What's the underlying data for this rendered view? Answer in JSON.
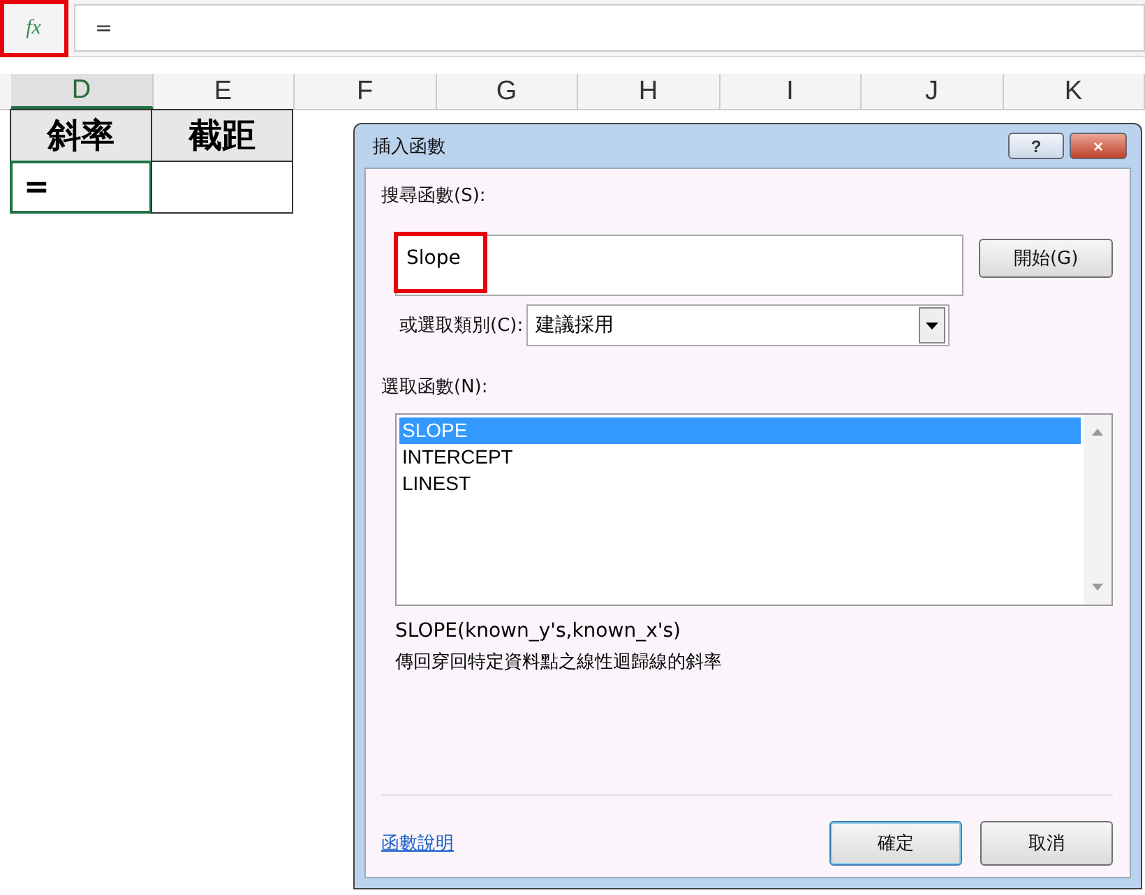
{
  "formula_bar": {
    "fx_label": "fx",
    "value": "="
  },
  "columns": [
    "D",
    "E",
    "F",
    "G",
    "H",
    "I",
    "J",
    "K"
  ],
  "cells": [
    [
      "斜率",
      "="
    ],
    [
      "截距"
    ]
  ],
  "dialog": {
    "title": "插入函數",
    "help_button": "?",
    "close_button": "×",
    "search_label": "搜尋函數(S):",
    "search_value": "Slope",
    "go_button": "開始(G)",
    "category_label": "或選取類別(C):",
    "category_value": "建議採用",
    "functions_label": "選取函數(N):",
    "functions": [
      {
        "name": "SLOPE",
        "selected": true
      },
      {
        "name": "INTERCEPT",
        "selected": false
      },
      {
        "name": "LINEST",
        "selected": false
      }
    ],
    "signature": "SLOPE(known_y's,known_x's)",
    "description": "傳回穿回特定資料點之線性迴歸線的斜率",
    "help_link": "函數說明",
    "ok_button": "確定",
    "cancel_button": "取消"
  }
}
